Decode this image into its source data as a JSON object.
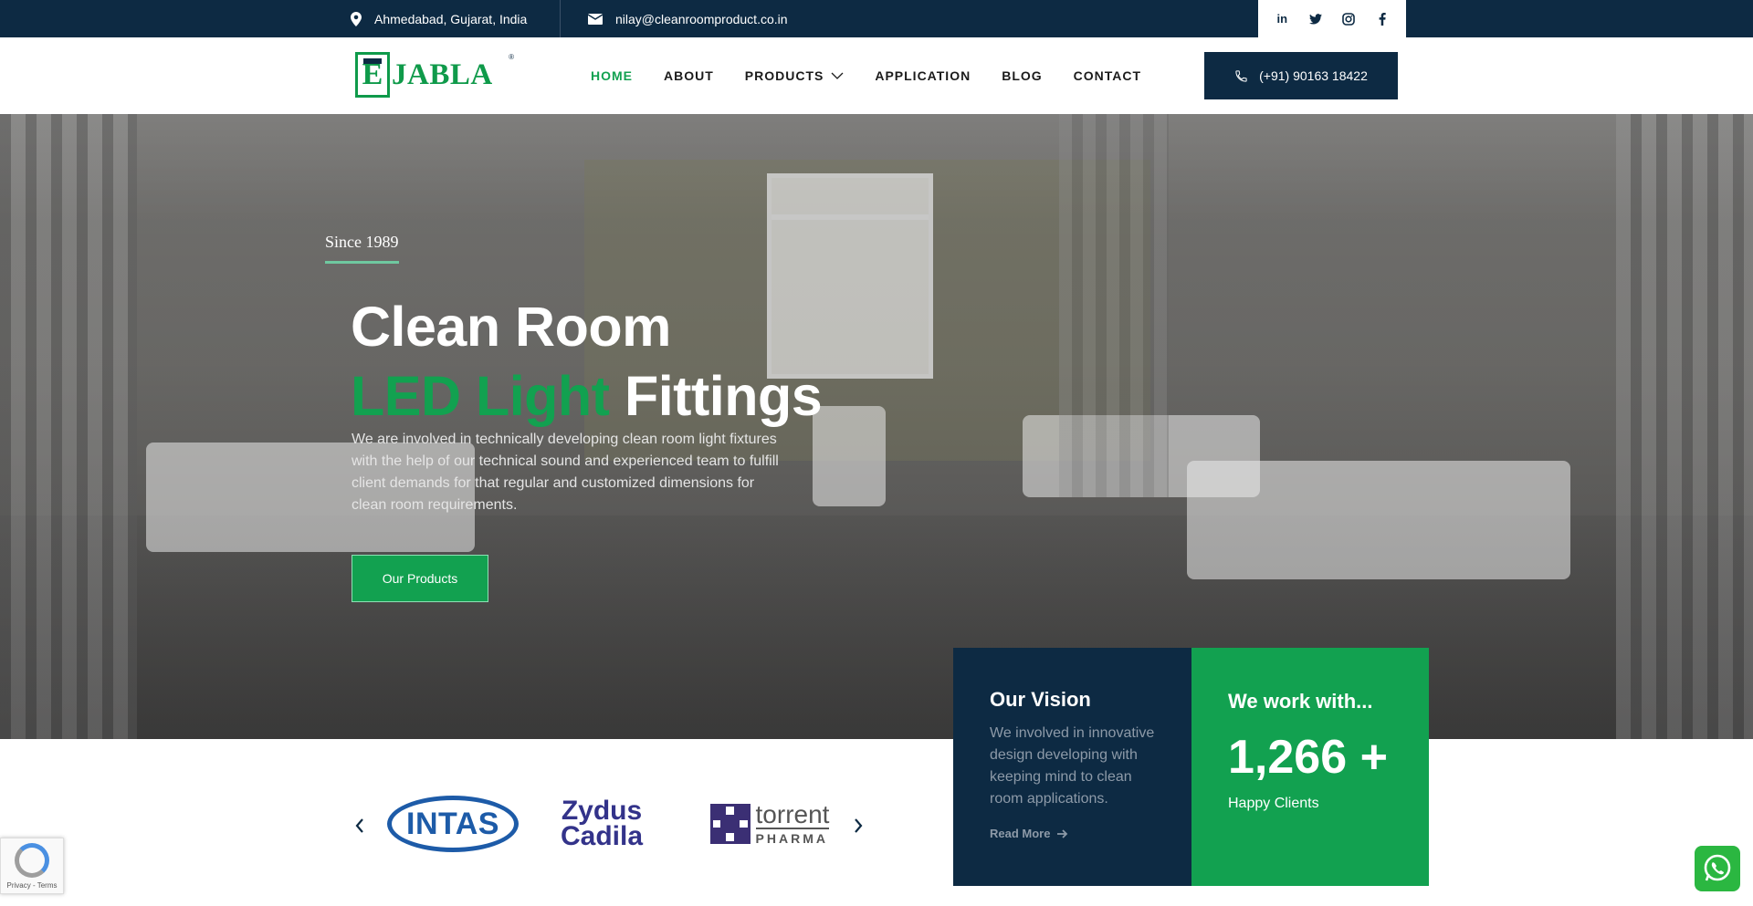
{
  "topbar": {
    "location": "Ahmedabad, Gujarat, India",
    "email": "nilay@cleanroomproduct.co.in",
    "social": [
      "linkedin-icon",
      "twitter-icon",
      "instagram-icon",
      "facebook-icon"
    ]
  },
  "header": {
    "logo_text": "JABLA",
    "logo_mark": "E",
    "logo_reg": "®",
    "nav": [
      {
        "label": "HOME",
        "active": true
      },
      {
        "label": "ABOUT"
      },
      {
        "label": "PRODUCTS",
        "has_dropdown": true
      },
      {
        "label": "APPLICATION"
      },
      {
        "label": "BLOG"
      },
      {
        "label": "CONTACT"
      }
    ],
    "phone": "(+91) 90163 18422"
  },
  "hero": {
    "since": "Since 1989",
    "title_line1": "Clean Room",
    "title_green": "LED Light",
    "title_rest": "Fittings",
    "description": "We are involved in technically developing clean room light fixtures with the help of our technical sound and experienced team to fulfill client demands for that regular and customized dimensions for clean room requirements.",
    "cta": "Our Products"
  },
  "vision": {
    "title": "Our Vision",
    "text": "We involved in innovative design developing with keeping mind to clean room applications.",
    "link": "Read More"
  },
  "stats": {
    "title": "We work with...",
    "count": "1,266 +",
    "label": "Happy Clients"
  },
  "clients": {
    "intas": "INTAS",
    "zydus_line1": "Zydus",
    "zydus_line2": "Cadila",
    "torrent_line1": "torrent",
    "torrent_line2": "PHARMA"
  },
  "recaptcha": {
    "text": "Privacy - Terms"
  },
  "colors": {
    "navy": "#0d2a43",
    "green": "#12a150",
    "whatsapp": "#2bb741"
  }
}
